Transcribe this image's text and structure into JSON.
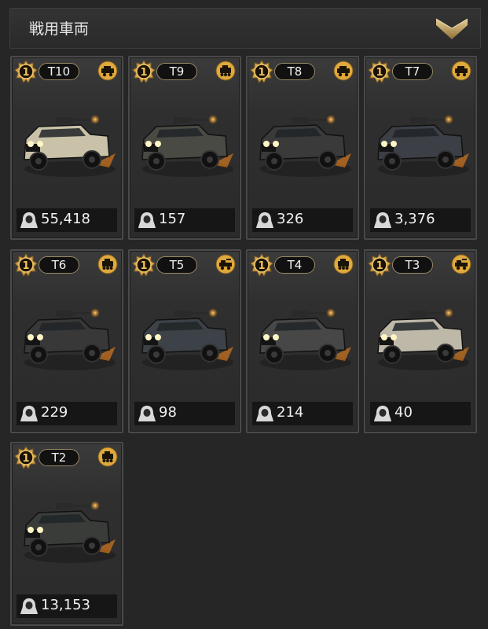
{
  "header": {
    "title": "戦用車両"
  },
  "vehicles": [
    {
      "tier": "T10",
      "rank": "1",
      "count": "55,418",
      "type_icon": "armored-truck-icon",
      "accent": "#c9c2a8"
    },
    {
      "tier": "T9",
      "rank": "1",
      "count": "157",
      "type_icon": "apc-icon",
      "accent": "#4a4a44"
    },
    {
      "tier": "T8",
      "rank": "1",
      "count": "326",
      "type_icon": "armored-truck-icon",
      "accent": "#3a3a3a"
    },
    {
      "tier": "T7",
      "rank": "1",
      "count": "3,376",
      "type_icon": "armored-truck-icon",
      "accent": "#3c4046"
    },
    {
      "tier": "T6",
      "rank": "1",
      "count": "229",
      "type_icon": "apc-icon",
      "accent": "#383838"
    },
    {
      "tier": "T5",
      "rank": "1",
      "count": "98",
      "type_icon": "pickup-gun-icon",
      "accent": "#3c4248"
    },
    {
      "tier": "T4",
      "rank": "1",
      "count": "214",
      "type_icon": "apc-icon",
      "accent": "#474747"
    },
    {
      "tier": "T3",
      "rank": "1",
      "count": "40",
      "type_icon": "pickup-gun-icon",
      "accent": "#bdb8a8"
    },
    {
      "tier": "T2",
      "rank": "1",
      "count": "13,153",
      "type_icon": "apc-icon",
      "accent": "#3a3c3a"
    }
  ]
}
